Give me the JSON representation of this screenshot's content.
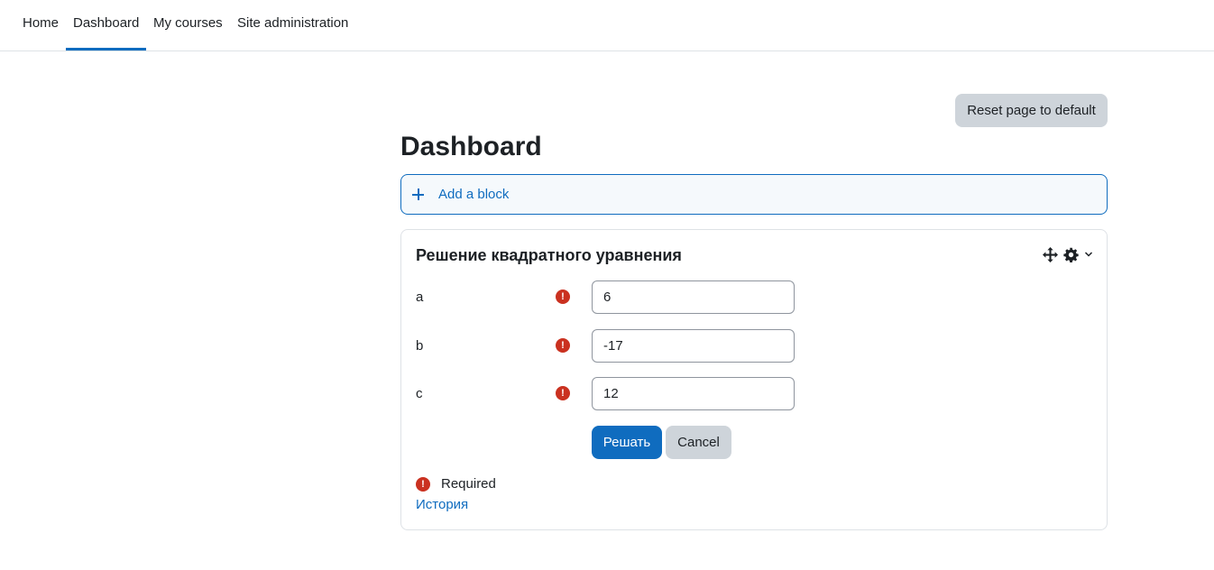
{
  "nav": {
    "items": [
      {
        "label": "Home"
      },
      {
        "label": "Dashboard"
      },
      {
        "label": "My courses"
      },
      {
        "label": "Site administration"
      }
    ],
    "active": "Dashboard"
  },
  "reset_button": "Reset page to default",
  "page_title": "Dashboard",
  "add_block": {
    "label": "Add a block"
  },
  "block": {
    "title": "Решение квадратного уравнения",
    "fields": [
      {
        "label": "a",
        "value": "6"
      },
      {
        "label": "b",
        "value": "-17"
      },
      {
        "label": "c",
        "value": "12"
      }
    ],
    "submit_label": "Решать",
    "cancel_label": "Cancel",
    "required_icon": "!",
    "required_text": "Required",
    "history_link": "История"
  },
  "colors": {
    "accent": "#0f6cbf",
    "required": "#ca3120",
    "secondary_button": "#ced4da"
  },
  "icons": [
    "move-icon",
    "gear-icon",
    "chevron-down-icon",
    "plus-icon",
    "required-icon"
  ]
}
